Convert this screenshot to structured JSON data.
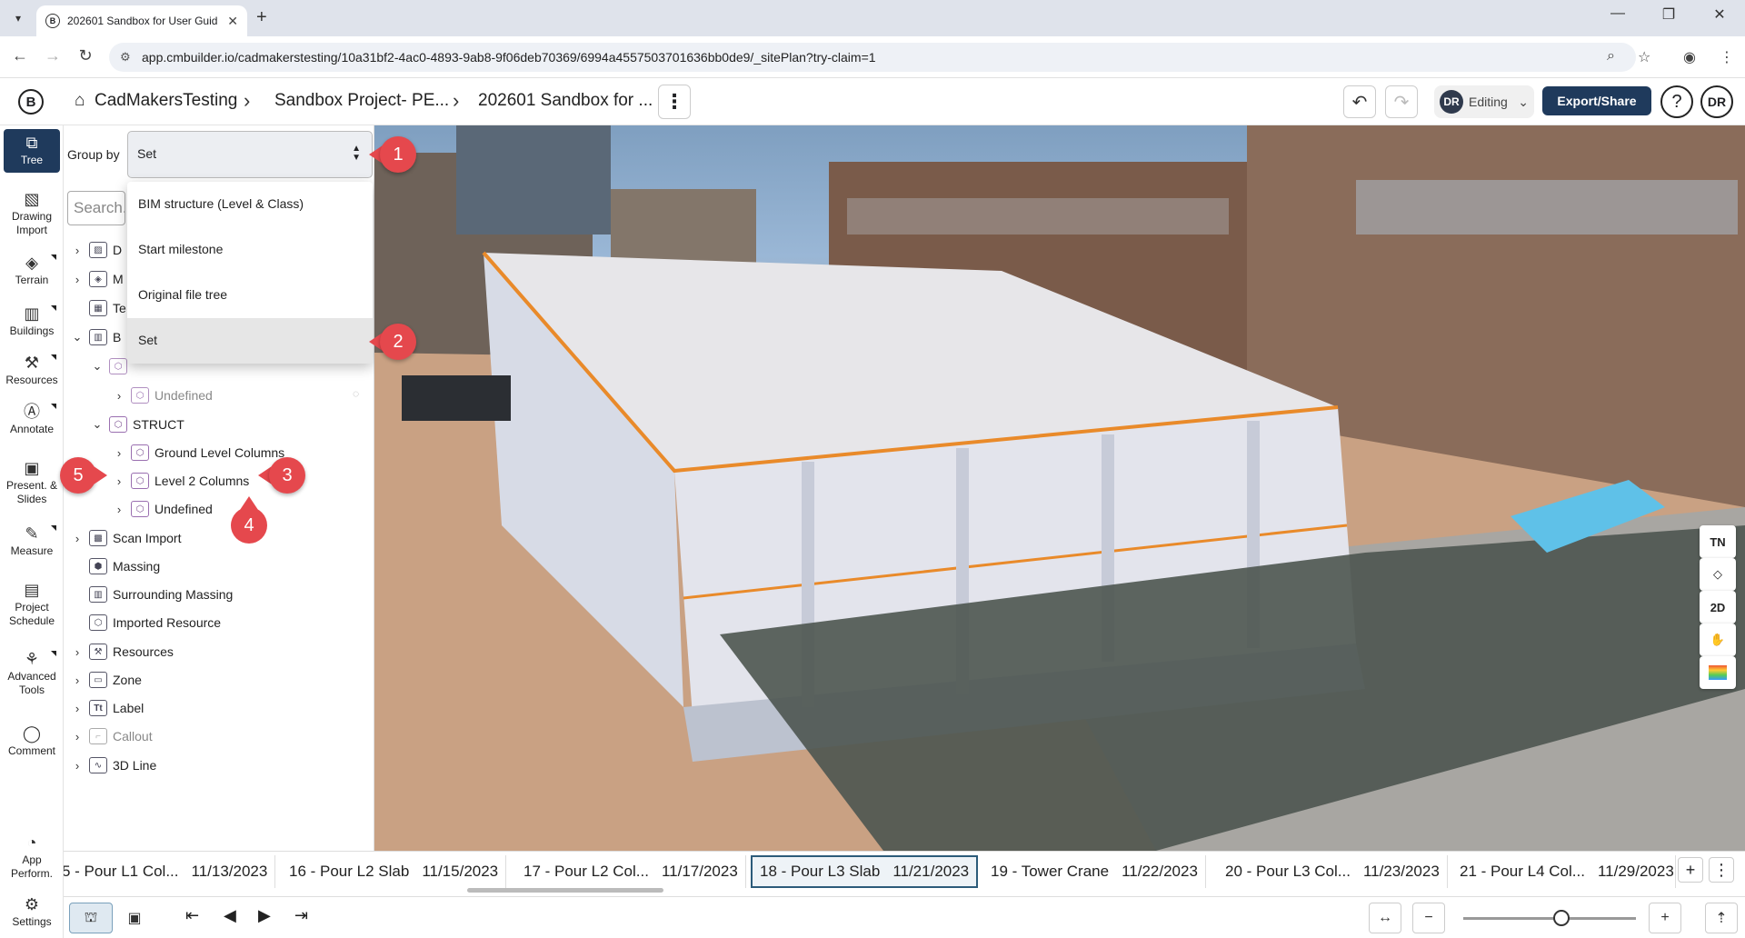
{
  "browser": {
    "tab_title": "202601 Sandbox for User Guid",
    "url": "app.cmbuilder.io/cadmakerstesting/10a31bf2-4ac0-4893-9ab8-9f06deb70369/6994a4557503701636bb0de9/_sitePlan?try-claim=1"
  },
  "header": {
    "logo": "B",
    "breadcrumbs": [
      "CadMakersTesting",
      "Sandbox Project- PE...",
      "202601 Sandbox for ..."
    ],
    "mode": "Editing",
    "user_initials": "DR",
    "export_label": "Export/Share",
    "help": "?"
  },
  "left_tools": [
    {
      "label": "Tree",
      "icon": "tree-icon"
    },
    {
      "label": "Drawing Import",
      "icon": "drawing-import-icon"
    },
    {
      "label": "Terrain",
      "icon": "terrain-icon"
    },
    {
      "label": "Buildings",
      "icon": "buildings-icon"
    },
    {
      "label": "Resources",
      "icon": "resources-icon"
    },
    {
      "label": "Annotate",
      "icon": "annotate-icon"
    },
    {
      "label": "Present. & Slides",
      "icon": "present-icon"
    },
    {
      "label": "Measure",
      "icon": "measure-icon"
    },
    {
      "label": "Project Schedule",
      "icon": "schedule-icon"
    },
    {
      "label": "Advanced Tools",
      "icon": "advanced-tools-icon"
    },
    {
      "label": "Comment",
      "icon": "comment-icon"
    },
    {
      "label": "App Perform.",
      "icon": "app-performance-icon"
    },
    {
      "label": "Settings",
      "icon": "settings-icon"
    }
  ],
  "tree": {
    "group_by_label": "Group by",
    "group_by_value": "Set",
    "search_placeholder": "Search...",
    "dropdown_options": [
      "BIM structure (Level & Class)",
      "Start milestone",
      "Original file tree",
      "Set"
    ],
    "partial_rows": [
      "D",
      "M",
      "Te",
      "B"
    ],
    "rows": [
      {
        "label": "Undefined",
        "indent": 2
      },
      {
        "label": "STRUCT",
        "indent": 1
      },
      {
        "label": "Ground Level Columns",
        "indent": 2
      },
      {
        "label": "Level 2 Columns",
        "indent": 2
      },
      {
        "label": "Undefined",
        "indent": 2
      },
      {
        "label": "Scan Import",
        "indent": 0
      },
      {
        "label": "Massing",
        "indent": 0
      },
      {
        "label": "Surrounding Massing",
        "indent": 0
      },
      {
        "label": "Imported Resource",
        "indent": 0
      },
      {
        "label": "Resources",
        "indent": 0
      },
      {
        "label": "Zone",
        "indent": 0
      },
      {
        "label": "Label",
        "indent": 0
      },
      {
        "label": "Callout",
        "indent": 0
      },
      {
        "label": "3D Line",
        "indent": 0
      }
    ]
  },
  "markers": [
    "1",
    "2",
    "3",
    "4",
    "5"
  ],
  "view_controls": [
    "TN",
    "2D"
  ],
  "timeline": [
    {
      "name": "5 - Pour L1 Col...",
      "date": "11/13/2023"
    },
    {
      "name": "16 - Pour L2 Slab",
      "date": "11/15/2023"
    },
    {
      "name": "17 - Pour L2 Col...",
      "date": "11/17/2023"
    },
    {
      "name": "18 - Pour L3 Slab",
      "date": "11/21/2023"
    },
    {
      "name": "19 - Tower Crane",
      "date": "11/22/2023"
    },
    {
      "name": "20 - Pour L3 Col...",
      "date": "11/23/2023"
    },
    {
      "name": "21 - Pour L4 Col...",
      "date": "11/29/2023"
    }
  ],
  "zoom_level": 0.57,
  "colors": {
    "accent": "#1f3a5c",
    "marker": "#e5484d",
    "current_milestone_border": "#2c5b7a"
  }
}
